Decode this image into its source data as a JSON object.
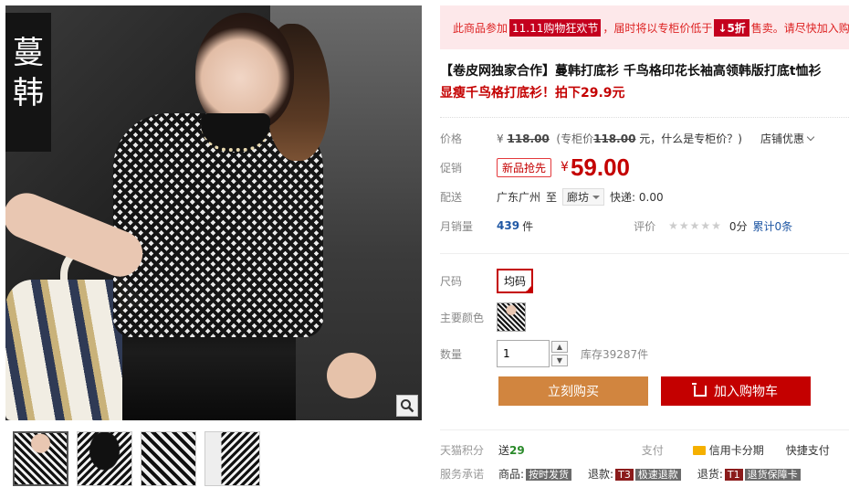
{
  "gallery": {
    "brand_tag_chars": [
      "蔓",
      "韩"
    ],
    "thumbnails": [
      "thumb-1",
      "thumb-2",
      "thumb-3",
      "thumb-4"
    ]
  },
  "promo": {
    "prefix": "此商品参加",
    "event_tag": "11.11购物狂欢节",
    "middle": "，届时将以专柜价低于",
    "discount": "↓5折",
    "suffix": "售卖。请尽快加入购物车"
  },
  "product": {
    "title_line1": "【卷皮网独家合作】蔓韩打底衫 千鸟格印花长袖高领韩版打底t恤衫",
    "title_line2": "显瘦千鸟格打底衫！拍下29.9元"
  },
  "price_row": {
    "label": "价格",
    "currency": "¥",
    "orig_price": "118.00",
    "note_prefix": "(专柜价",
    "note_price": "118.00",
    "note_suffix": "元，什么是专柜价？)",
    "shop_discount": "店铺优惠"
  },
  "promo_row": {
    "label": "促销",
    "badge": "新品抢先",
    "currency": "¥",
    "price": "59.00"
  },
  "shipping_row": {
    "label": "配送",
    "from": "广东广州",
    "to_word": "至",
    "destination": "廊坊",
    "express": "快递: 0.00"
  },
  "sales_row": {
    "label": "月销量",
    "count": "439",
    "unit": "件",
    "review_label": "评价",
    "stars": "★★★★★",
    "score": "0分",
    "review_count": "累计0条"
  },
  "options": {
    "size_label": "尺码",
    "size_value": "均码",
    "color_label": "主要颜色",
    "qty_label": "数量",
    "qty_value": "1",
    "stock": "库存39287件"
  },
  "actions": {
    "buy": "立刻购买",
    "cart": "加入购物车"
  },
  "footer": {
    "points_label": "天猫积分",
    "points_prefix": "送",
    "points_value": "29",
    "pay_label": "支付",
    "pay_card": "信用卡分期",
    "pay_quick": "快捷支付",
    "service_label": "服务承诺",
    "svc1_prefix": "商品:",
    "svc1_tag": "按时发货",
    "svc2_prefix": "退款:",
    "svc2_code": "T3",
    "svc2_tag": "极速退款",
    "svc3_prefix": "退货:",
    "svc3_code": "T1",
    "svc3_tag": "退货保障卡"
  },
  "colors": {
    "accent_red": "#c40000",
    "buy_orange": "#d1853f",
    "promo_bg": "#fde8ea"
  }
}
